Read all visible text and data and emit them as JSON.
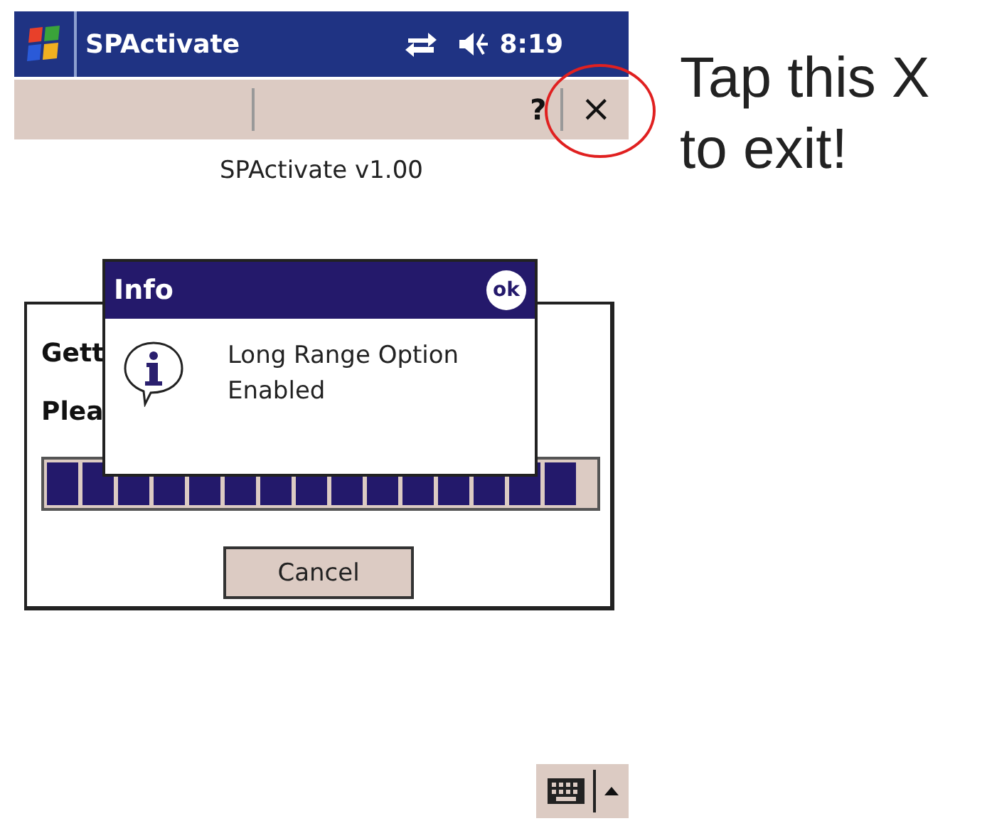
{
  "title_bar": {
    "title": "SPActivate",
    "time": "8:19"
  },
  "menu_bar": {
    "help": "?",
    "close": "×"
  },
  "version": "SPActivate v1.00",
  "dialog": {
    "line_1": "Gett",
    "line_2": "Plea",
    "progress": {
      "level": 0.97
    },
    "cancel": "Cancel"
  },
  "popup": {
    "title": "Info",
    "ok": "ok",
    "message": "Long Range Option Enabled"
  },
  "annotation": {
    "line_1": "Tap this X",
    "line_2": "to exit!"
  }
}
